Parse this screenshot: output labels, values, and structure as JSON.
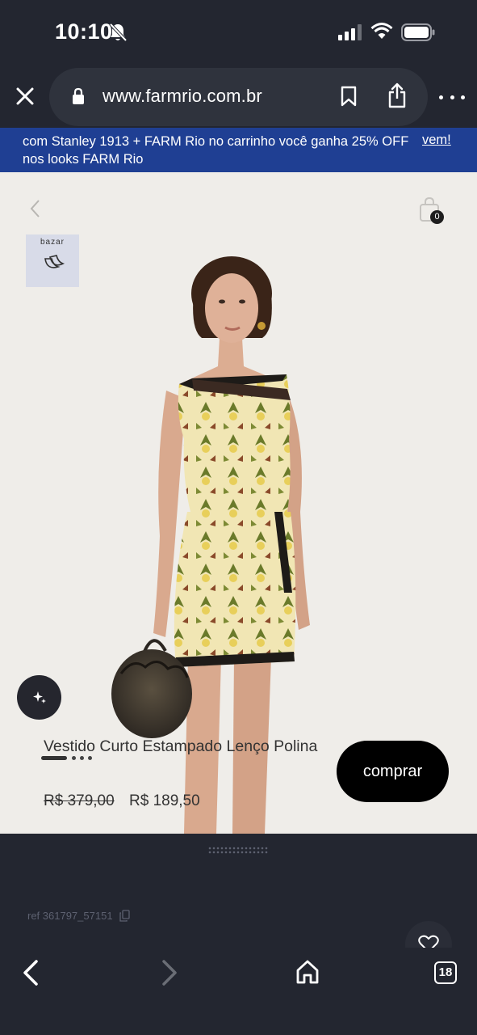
{
  "status_bar": {
    "time": "10:10",
    "icons": [
      "bell-muted-icon",
      "cellular-signal-icon",
      "wifi-icon",
      "battery-icon"
    ]
  },
  "browser": {
    "url": "www.farmrio.com.br",
    "icons": [
      "close-icon",
      "lock-icon",
      "bookmark-icon",
      "share-icon",
      "more-icon"
    ]
  },
  "promo": {
    "text": "com Stanley 1913 + FARM Rio no carrinho você ganha 25% OFF nos looks FARM Rio",
    "link": "vem!",
    "background": "#1f3f93"
  },
  "product": {
    "bag_count": "0",
    "brand_badge": "bazar",
    "name": "Vestido Curto Estampado Lenço Polina",
    "old_price": "R$ 379,00",
    "new_price": "R$ 189,50",
    "buy_label": "comprar",
    "carousel": {
      "total": 4,
      "active": 1
    }
  },
  "details": {
    "ref": "ref 361797_57151"
  },
  "toolbar": {
    "tab_count": "18",
    "icons": [
      "back-arrow-icon",
      "forward-arrow-icon",
      "home-icon",
      "tabs-icon"
    ]
  },
  "colors": {
    "chrome_dark": "#232630",
    "photo_background": "#efede9",
    "buy_button": "#000000"
  }
}
